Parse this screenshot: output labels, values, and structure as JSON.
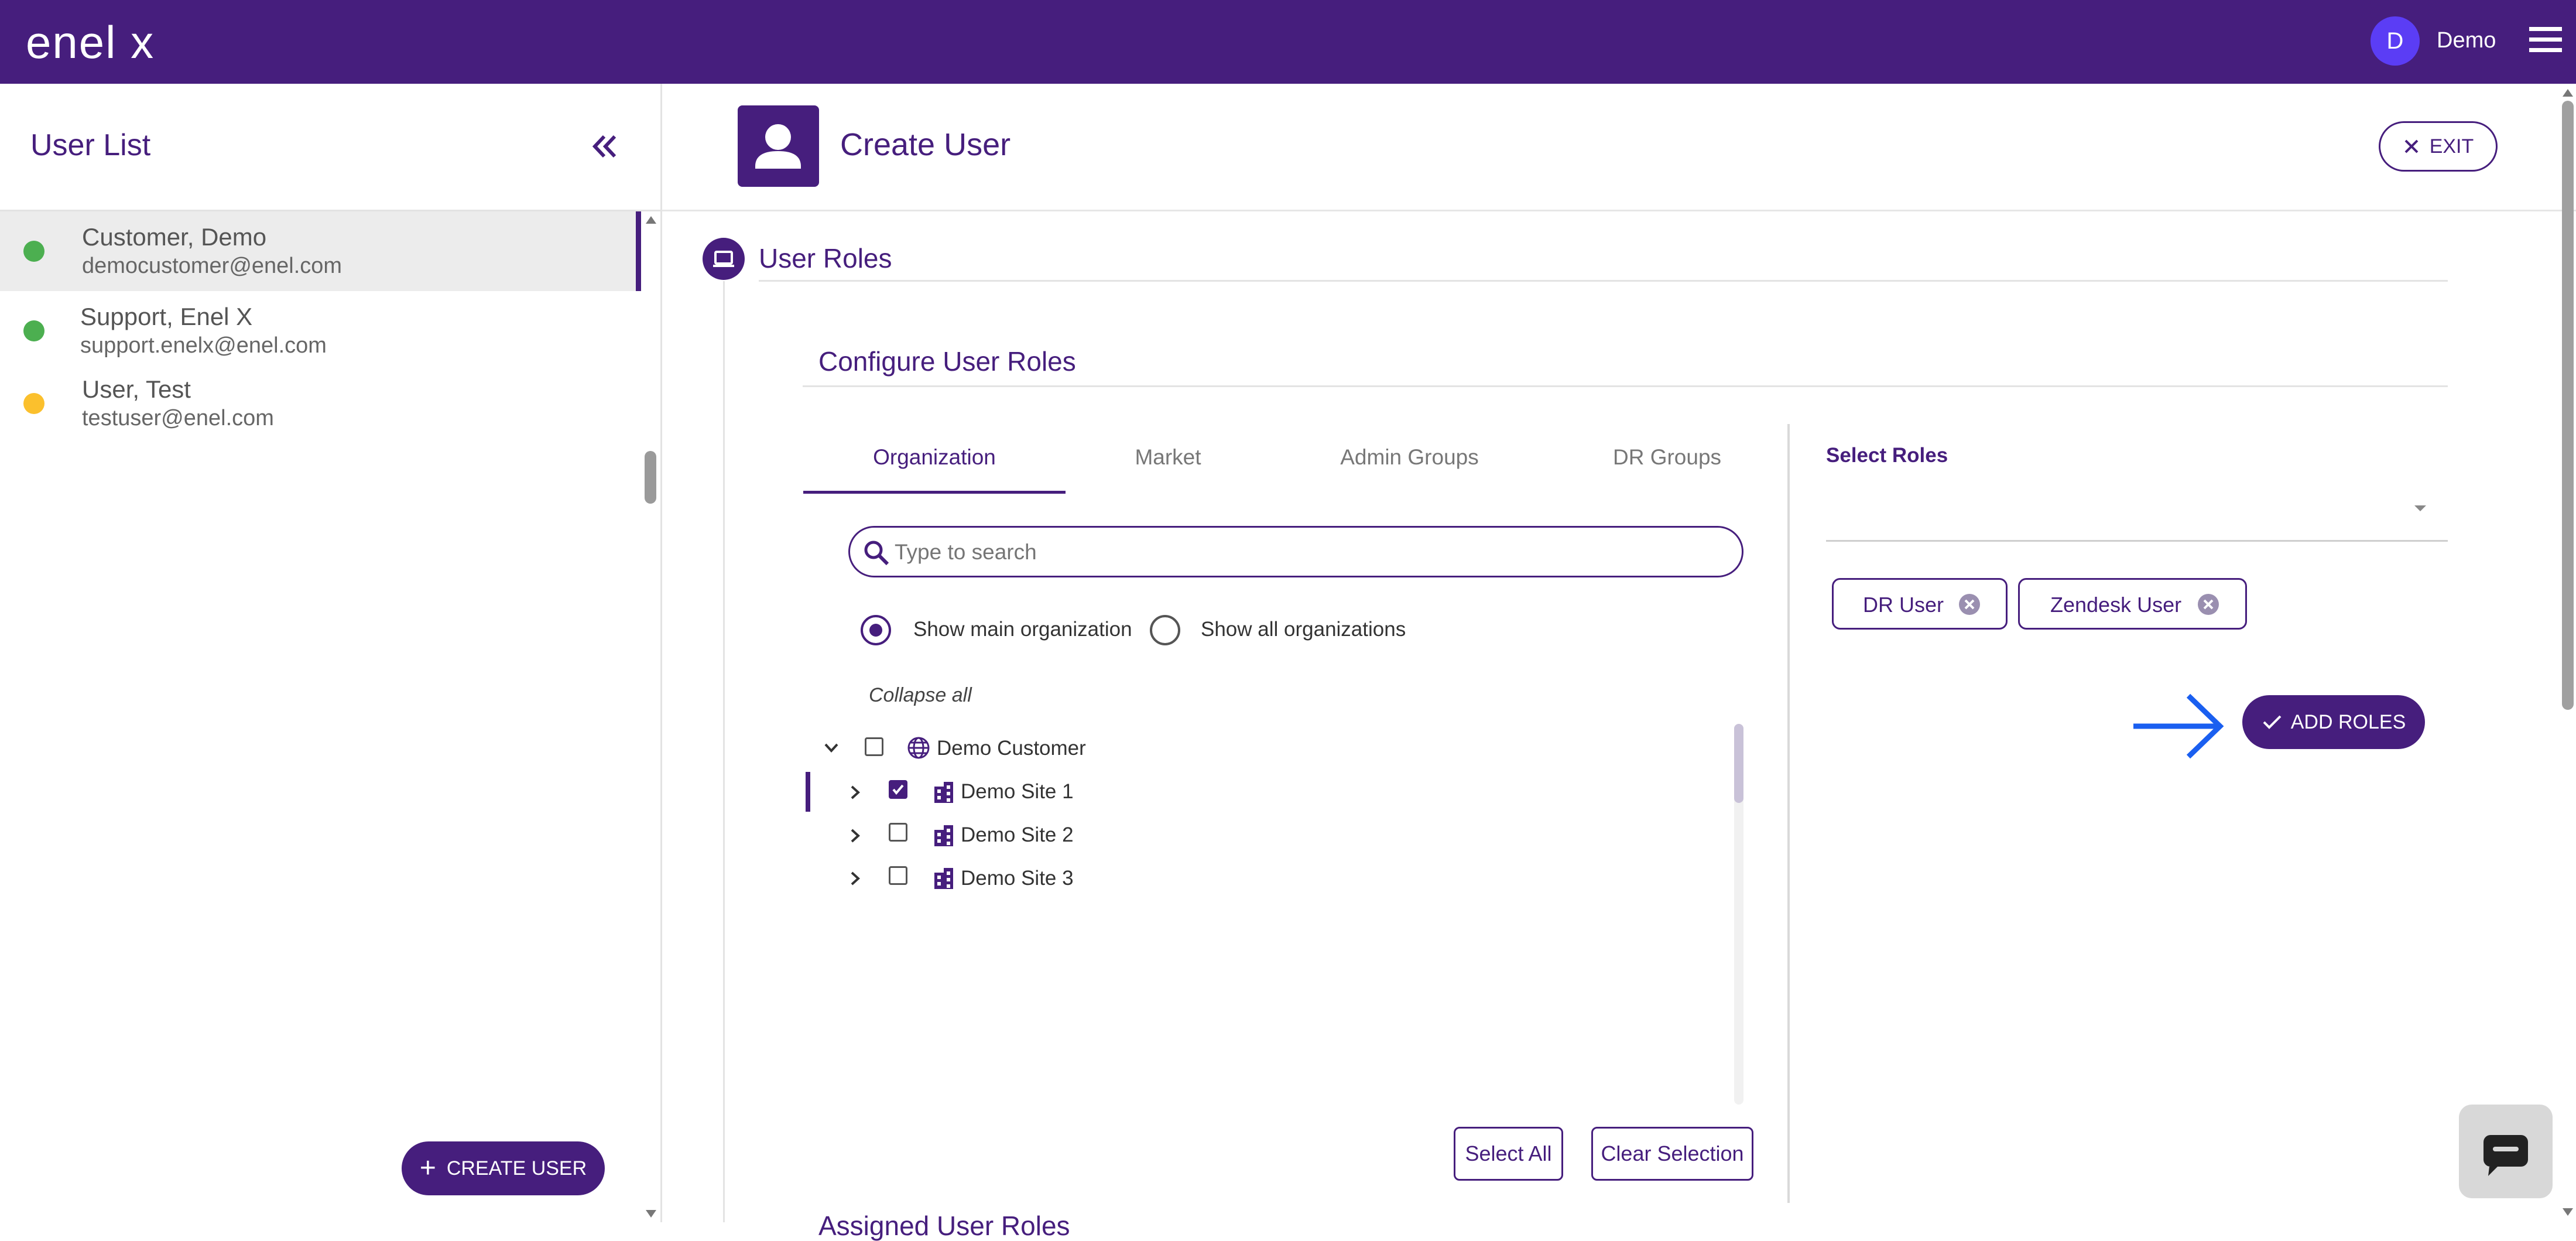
{
  "brand": {
    "logo_text": "enel x",
    "logo_color": "#ffffff",
    "topbar_color": "#461e7d"
  },
  "header": {
    "avatar_letter": "D",
    "user_name": "Demo",
    "menu_icon": "hamburger-icon"
  },
  "sidebar": {
    "title": "User List",
    "collapse_icon": "double-chevron-left-icon",
    "users": [
      {
        "name": "Customer, Demo",
        "email": "democustomer@enel.com",
        "status_color": "#4caf50",
        "selected": true
      },
      {
        "name": "Support, Enel X",
        "email": "support.enelx@enel.com",
        "status_color": "#4caf50",
        "selected": false
      },
      {
        "name": "User, Test",
        "email": "testuser@enel.com",
        "status_color": "#fbc02d",
        "selected": false
      }
    ],
    "create_user_label": "CREATE USER"
  },
  "page": {
    "title": "Create User",
    "exit_label": "EXIT",
    "section_title": "User Roles",
    "configure_title": "Configure User Roles",
    "truncated_next_section": "Assigned User Roles"
  },
  "tabs": [
    {
      "label": "Organization",
      "active": true
    },
    {
      "label": "Market",
      "active": false
    },
    {
      "label": "Admin Groups",
      "active": false
    },
    {
      "label": "DR Groups",
      "active": false
    }
  ],
  "search": {
    "placeholder": "Type to search"
  },
  "org_filter": {
    "options": [
      {
        "label": "Show main organization",
        "selected": true
      },
      {
        "label": "Show all organizations",
        "selected": false
      }
    ],
    "collapse_all_label": "Collapse all"
  },
  "tree": {
    "root": {
      "label": "Demo Customer",
      "checked": false,
      "expanded": true
    },
    "children": [
      {
        "label": "Demo Site 1",
        "checked": true
      },
      {
        "label": "Demo Site 2",
        "checked": false
      },
      {
        "label": "Demo Site 3",
        "checked": false
      }
    ]
  },
  "tree_actions": {
    "select_all_label": "Select All",
    "clear_selection_label": "Clear Selection"
  },
  "roles": {
    "select_label": "Select Roles",
    "selected_roles": [
      "DR User",
      "Zendesk User"
    ],
    "add_roles_label": "ADD ROLES"
  },
  "colors": {
    "accent": "#461e7d",
    "arrow": "#1a5ff0"
  }
}
